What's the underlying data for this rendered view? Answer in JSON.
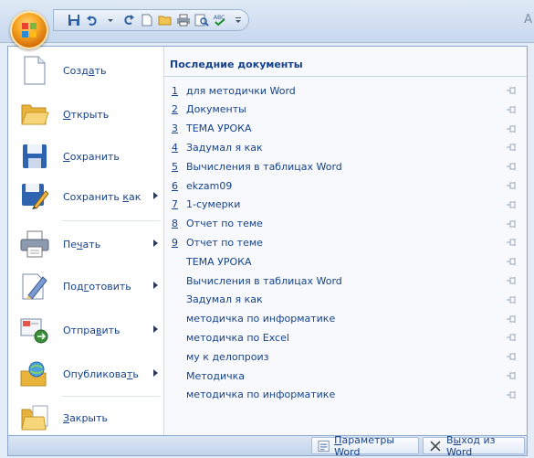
{
  "window": {
    "corner_text": "A"
  },
  "quick_access": [
    "save-icon",
    "undo-icon",
    "redo-icon",
    "new-icon",
    "open-icon",
    "print-icon",
    "print-preview-icon",
    "spelling-icon",
    "customize-dropdown-icon"
  ],
  "commands": [
    {
      "label_pre": "Созд",
      "label_u": "а",
      "label_post": "ть",
      "icon": "new-document-icon",
      "submenu": false
    },
    {
      "label_pre": "",
      "label_u": "О",
      "label_post": "ткрыть",
      "icon": "open-folder-icon",
      "submenu": false
    },
    {
      "label_pre": "",
      "label_u": "С",
      "label_post": "охранить",
      "icon": "save-icon",
      "submenu": false
    },
    {
      "label_pre": "Сохранить ",
      "label_u": "к",
      "label_post": "ак",
      "icon": "save-as-icon",
      "submenu": true
    },
    {
      "label_pre": "Пе",
      "label_u": "ч",
      "label_post": "ать",
      "icon": "printer-icon",
      "submenu": true
    },
    {
      "label_pre": "Под",
      "label_u": "г",
      "label_post": "отовить",
      "icon": "prepare-icon",
      "submenu": true
    },
    {
      "label_pre": "Отпра",
      "label_u": "в",
      "label_post": "ить",
      "icon": "send-icon",
      "submenu": true
    },
    {
      "label_pre": "Опубликова",
      "label_u": "т",
      "label_post": "ь",
      "icon": "publish-icon",
      "submenu": true
    },
    {
      "label_pre": "",
      "label_u": "З",
      "label_post": "акрыть",
      "icon": "close-folder-icon",
      "submenu": false
    }
  ],
  "recent": {
    "title": "Последние документы",
    "items": [
      {
        "num": "1",
        "name": "для методички Word"
      },
      {
        "num": "2",
        "name": "Документы"
      },
      {
        "num": "3",
        "name": "ТЕМА УРОКА"
      },
      {
        "num": "4",
        "name": "Задумал я как"
      },
      {
        "num": "5",
        "name": "Вычисления в таблицах Word"
      },
      {
        "num": "6",
        "name": "ekzam09"
      },
      {
        "num": "7",
        "name": "1-сумерки"
      },
      {
        "num": "8",
        "name": "Отчет по теме"
      },
      {
        "num": "9",
        "name": "Отчет по теме"
      },
      {
        "num": "",
        "name": "ТЕМА УРОКА"
      },
      {
        "num": "",
        "name": "Вычисления в таблицах Word"
      },
      {
        "num": "",
        "name": "Задумал я как"
      },
      {
        "num": "",
        "name": "методичка по информатике"
      },
      {
        "num": "",
        "name": "методичка по Excel"
      },
      {
        "num": "",
        "name": "му к делопроиз"
      },
      {
        "num": "",
        "name": "Методичка"
      },
      {
        "num": "",
        "name": "методичка по информатике"
      }
    ]
  },
  "footer": {
    "options_pre": "",
    "options_u": "П",
    "options_post": "араметры Word",
    "exit_pre": "В",
    "exit_u": "ы",
    "exit_post": "ход из Word"
  }
}
